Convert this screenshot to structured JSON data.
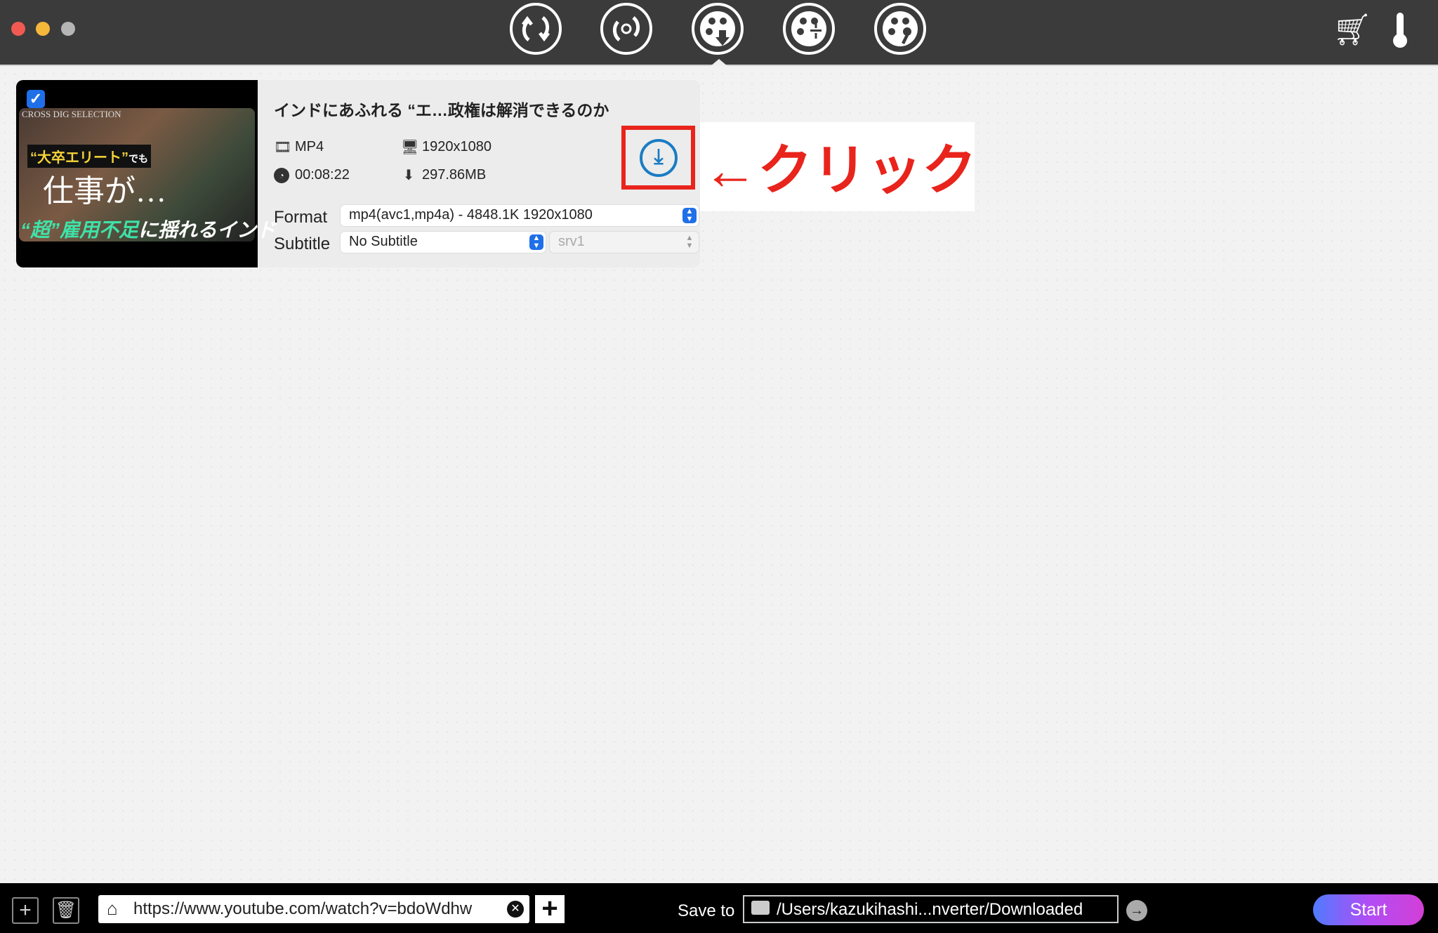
{
  "toolbar": {
    "icons": [
      "convert-icon",
      "rotate-convert-icon",
      "video-download-icon",
      "video-compress-icon",
      "video-repair-icon"
    ],
    "right_icons": [
      "cart-icon",
      "thermometer-icon"
    ],
    "active_index": 2
  },
  "item": {
    "checked": true,
    "thumbnail_text": {
      "brand": "CROSS DIG SELECTION",
      "tag": "“大卒エリート”",
      "tag_suffix": "でも",
      "headline": "仕事が…",
      "bottom_green": "“超”雇用不足",
      "bottom_white": "に揺れるインド"
    },
    "title": "インドにあふれる “エ…政権は解消できるのか",
    "container": "MP4",
    "resolution": "1920x1080",
    "duration": "00:08:22",
    "size": "297.86MB",
    "format_label": "Format",
    "format_value": "mp4(avc1,mp4a) - 4848.1K 1920x1080",
    "subtitle_label": "Subtitle",
    "subtitle_value": "No Subtitle",
    "subtitle_track": "srv1"
  },
  "annotation": {
    "text": "←クリック",
    "color": "#e8241c"
  },
  "bottom": {
    "url": "https://www.youtube.com/watch?v=bdoWdhw",
    "save_to_label": "Save to",
    "save_path": "/Users/kazukihashi...nverter/Downloaded",
    "start_label": "Start"
  },
  "colors": {
    "accent": "#1f6fe8",
    "download": "#1a7cc4",
    "toolbar": "#3b3b3b"
  }
}
